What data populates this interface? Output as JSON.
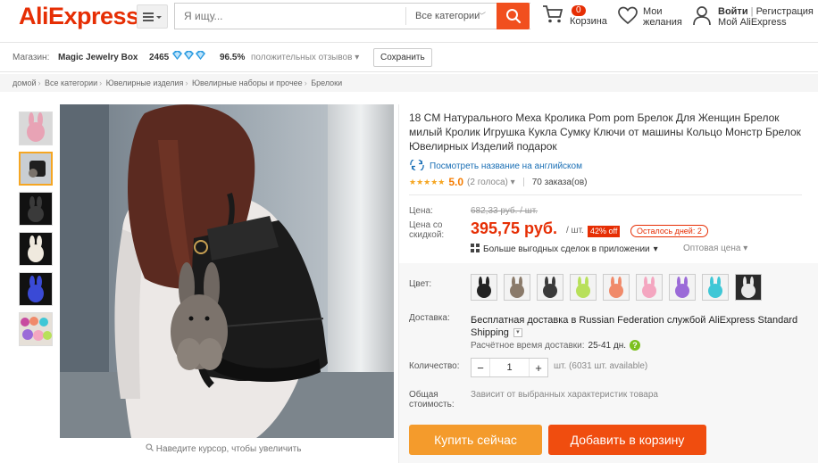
{
  "header": {
    "logo_text": "AliExpress",
    "logo_mark": "™",
    "search_placeholder": "Я ищу...",
    "search_category": "Все категории",
    "cart_count": "0",
    "cart_label": "Корзина",
    "wishlist_line1": "Мои",
    "wishlist_line2": "желания",
    "login_label": "Войти",
    "register_label": "Регистрация",
    "my_account_label": "Мой AliExpress"
  },
  "store": {
    "label": "Магазин:",
    "name": "Magic Jewelry Box",
    "score": "2465",
    "positive_pct": "96.5%",
    "feedback_label": "положительных отзывов",
    "save_label": "Сохранить"
  },
  "breadcrumb": [
    "домой",
    "Все категории",
    "Ювелирные изделия",
    "Ювелирные наборы и прочее",
    "Брелоки"
  ],
  "gallery": {
    "zoom_hint": "Наведите курсор, чтобы увеличить",
    "thumbnail_colors": [
      "#e8a3b5",
      "#2a2a2a",
      "#1b1b1b",
      "#efe9de",
      "#3a4ad6",
      "#c84aa0"
    ]
  },
  "product": {
    "title": "18 CM Натурального Меха Кролика Pom pom Брелок Для Женщин Брелок милый Кролик Игрушка Кукла Сумку Ключи от машины Кольцо Монстр Брелок Ювелирных Изделий подарок",
    "translate_link": "Посмотреть название на английском",
    "rating": "5.0",
    "votes": "(2 голоса)",
    "orders": "70 заказа(ов)",
    "price_label": "Цена:",
    "old_price": "682,33 руб. / шт.",
    "sale_label_1": "Цена со",
    "sale_label_2": "скидкой:",
    "sale_price": "395,75 руб.",
    "per_unit": "/ шт.",
    "discount": "42% off",
    "days_left": "Осталось дней: 2",
    "app_deals": "Больше выгодных сделок в приложении",
    "wholesale": "Оптовая цена",
    "color_label": "Цвет:",
    "swatch_colors": [
      "#222222",
      "#8a7a6a",
      "#3a3a3a",
      "#b8e05a",
      "#f08a6a",
      "#f4a6c0",
      "#9b6ad8",
      "#3ec7d6",
      "#e8e8e8"
    ],
    "shipping_label": "Доставка:",
    "shipping_bold": "Бесплатная доставка",
    "shipping_rest": " в Russian Federation службой AliExpress Standard Shipping",
    "eta_label": "Расчётное время доставки:",
    "eta_value": "25-41 дн.",
    "quantity_label": "Количество:",
    "quantity_value": "1",
    "quantity_available": "шт. (6031 шт. available)",
    "total_label_1": "Общая",
    "total_label_2": "стоимость:",
    "total_text": "Зависит от выбранных характеристик товара",
    "buy_now": "Купить сейчас",
    "add_to_cart": "Добавить в корзину"
  },
  "colors": {
    "brand_red": "#e62e04",
    "buy_orange": "#f49b2c",
    "cart_orange": "#f04d0f",
    "link_blue": "#1a6fb5",
    "star_gold": "#f5a623"
  }
}
